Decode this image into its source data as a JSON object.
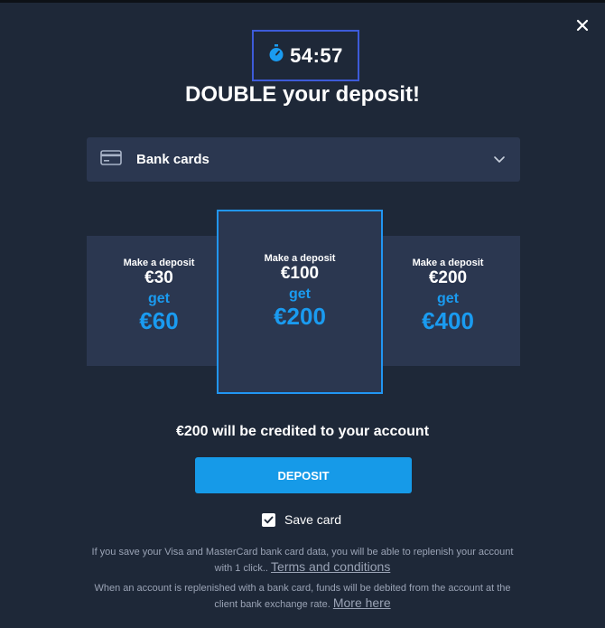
{
  "timer": {
    "value": "54:57",
    "icon": "stopwatch-icon"
  },
  "title": "DOUBLE your deposit!",
  "payment_method": {
    "label": "Bank cards",
    "icon": "credit-card-icon"
  },
  "offers": [
    {
      "make": "Make a deposit",
      "amount": "€30",
      "get": "get",
      "bonus": "€60"
    },
    {
      "make": "Make a deposit",
      "amount": "€100",
      "get": "get",
      "bonus": "€200",
      "selected": true
    },
    {
      "make": "Make a deposit",
      "amount": "€200",
      "get": "get",
      "bonus": "€400"
    }
  ],
  "credit_text": "€200 will be credited to your account",
  "deposit_label": "DEPOSIT",
  "save_card": {
    "label": "Save card",
    "checked": true
  },
  "info1": {
    "text": "If you save your Visa and MasterCard bank card data, you will be able to replenish your account with 1 click..",
    "link": "Terms and conditions"
  },
  "info2": {
    "text": "When an account is replenished with a bank card, funds will be debited from the account at the client bank exchange rate.",
    "link": "More here"
  },
  "colors": {
    "background": "#1e2838",
    "panel": "#2b3750",
    "accent": "#169ae8",
    "timer_border": "#3d5bd9"
  }
}
